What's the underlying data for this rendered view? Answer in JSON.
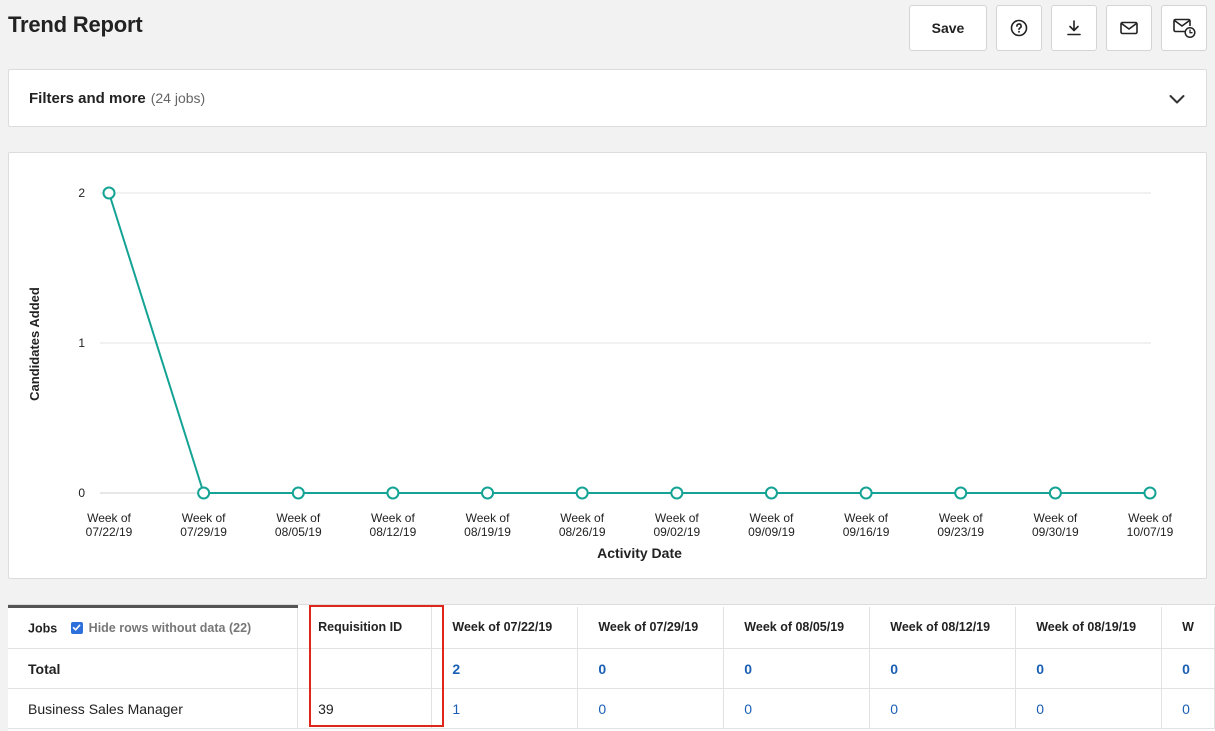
{
  "page": {
    "title": "Trend Report"
  },
  "toolbar": {
    "save_label": "Save",
    "icons": [
      "help-icon",
      "download-icon",
      "email-icon",
      "scheduled-email-icon"
    ]
  },
  "filters": {
    "title": "Filters and more",
    "count": "(24 jobs)"
  },
  "chart_data": {
    "type": "line",
    "title": "",
    "xlabel": "Activity Date",
    "ylabel": "Candidates Added",
    "categories": [
      "Week of 07/22/19",
      "Week of 07/29/19",
      "Week of 08/05/19",
      "Week of 08/12/19",
      "Week of 08/19/19",
      "Week of 08/26/19",
      "Week of 09/02/19",
      "Week of 09/09/19",
      "Week of 09/16/19",
      "Week of 09/23/19",
      "Week of 09/30/19",
      "Week of 10/07/19"
    ],
    "series": [
      {
        "values": [
          2,
          0,
          0,
          0,
          0,
          0,
          0,
          0,
          0,
          0,
          0,
          0
        ],
        "color": "#14a394"
      }
    ],
    "ylim": [
      0,
      2
    ],
    "yticks": [
      0,
      1,
      2
    ],
    "grid": true
  },
  "table": {
    "jobs_header": "Jobs",
    "hide_rows_label": "Hide rows without data (22)",
    "req_header": "Requisition ID",
    "week_headers": [
      "Week of 07/22/19",
      "Week of 07/29/19",
      "Week of 08/05/19",
      "Week of 08/12/19",
      "Week of 08/19/19",
      "W"
    ],
    "total_row": {
      "label": "Total",
      "req": "",
      "values": [
        "2",
        "0",
        "0",
        "0",
        "0",
        "0"
      ]
    },
    "rows": [
      {
        "label": "Business Sales Manager",
        "req": "39",
        "values": [
          "1",
          "0",
          "0",
          "0",
          "0",
          "0"
        ]
      }
    ]
  },
  "colors": {
    "accent": "#14a394",
    "link": "#1a5fb4",
    "highlight": "#e0261b"
  }
}
